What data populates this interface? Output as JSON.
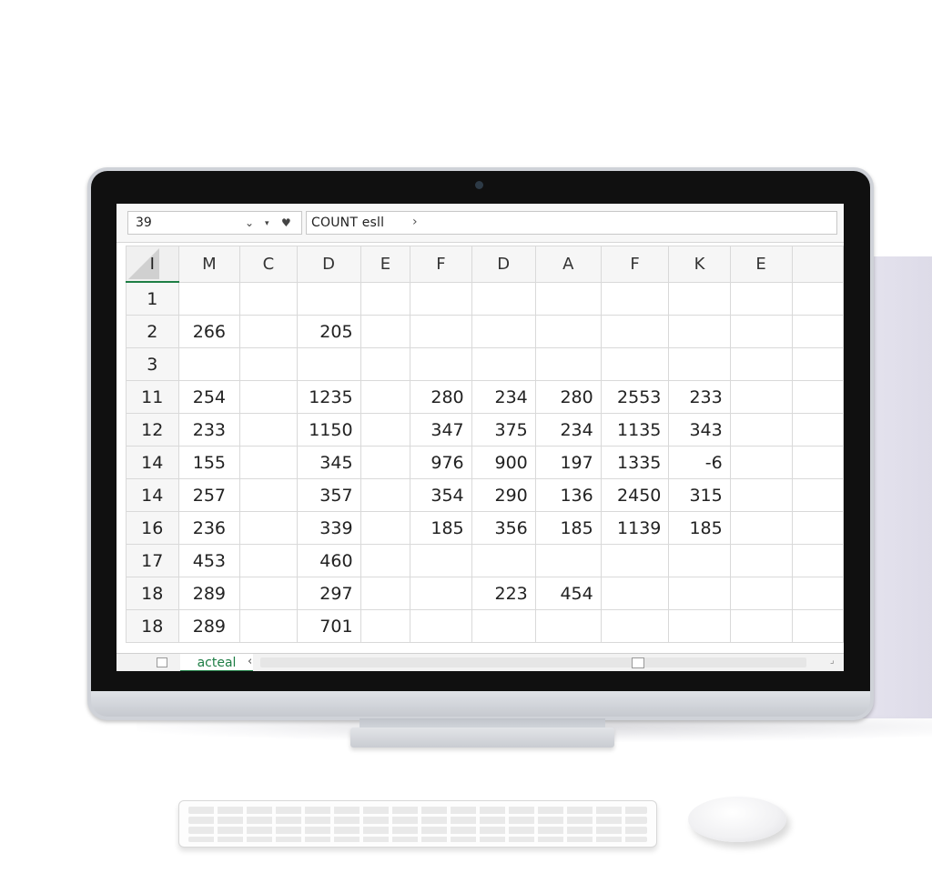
{
  "formula_bar": {
    "name_box_value": "39",
    "formula_text": "COUNT   esll",
    "icons": [
      "chevron-down-icon",
      "caret-down-icon",
      "heart-icon",
      "chevron-right-icon"
    ]
  },
  "grid": {
    "corner_label": "I",
    "columns": [
      "M",
      "C",
      "D",
      "E",
      "F",
      "D",
      "A",
      "F",
      "K",
      "E",
      ""
    ],
    "rows": [
      {
        "header": "1",
        "cells": [
          "",
          "",
          "",
          "",
          "",
          "",
          "",
          "",
          "",
          "",
          ""
        ]
      },
      {
        "header": "2",
        "cells": [
          "266",
          "",
          "205",
          "",
          "",
          "",
          "",
          "",
          "",
          "",
          ""
        ]
      },
      {
        "header": "3",
        "cells": [
          "",
          "",
          "",
          "",
          "",
          "",
          "",
          "",
          "",
          "",
          ""
        ]
      },
      {
        "header": "11",
        "cells": [
          "254",
          "",
          "1235",
          "",
          "280",
          "234",
          "280",
          "2553",
          "233",
          "",
          ""
        ]
      },
      {
        "header": "12",
        "cells": [
          "233",
          "",
          "1150",
          "",
          "347",
          "375",
          "234",
          "1135",
          "343",
          "",
          ""
        ]
      },
      {
        "header": "14",
        "cells": [
          "155",
          "",
          "345",
          "",
          "976",
          "900",
          "197",
          "1335",
          "-6",
          "",
          ""
        ]
      },
      {
        "header": "14",
        "cells": [
          "257",
          "",
          "357",
          "",
          "354",
          "290",
          "136",
          "2450",
          "315",
          "",
          ""
        ]
      },
      {
        "header": "16",
        "cells": [
          "236",
          "",
          "339",
          "",
          "185",
          "356",
          "185",
          "1139",
          "185",
          "",
          ""
        ]
      },
      {
        "header": "17",
        "cells": [
          "453",
          "",
          "460",
          "",
          "",
          "",
          "",
          "",
          "",
          "",
          ""
        ]
      },
      {
        "header": "18",
        "cells": [
          "289",
          "",
          "297",
          "",
          "",
          "223",
          "454",
          "",
          "",
          "",
          ""
        ]
      },
      {
        "header": "18",
        "cells": [
          "289",
          "",
          "701",
          "",
          "",
          "",
          "",
          "",
          "",
          "",
          ""
        ]
      }
    ]
  },
  "status_bar": {
    "sheet_tab": "acteal",
    "tab_scroll_glyph": "‹",
    "resize_glyph": "⌟"
  }
}
